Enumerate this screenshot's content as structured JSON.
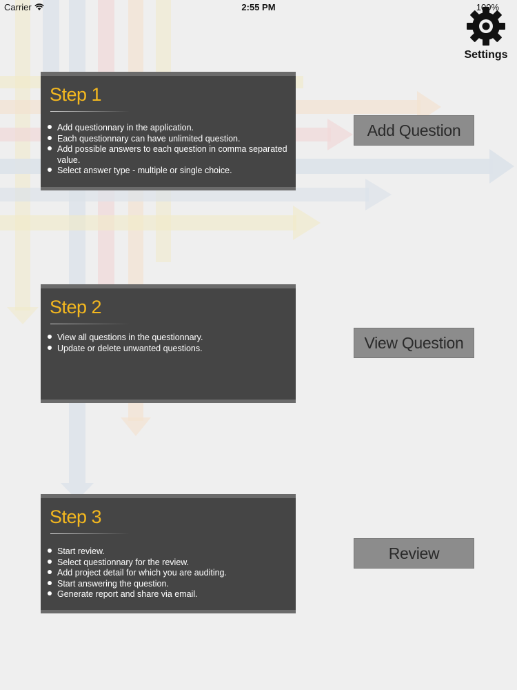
{
  "status_bar": {
    "carrier": "Carrier",
    "time": "2:55 PM",
    "battery": "100%"
  },
  "settings": {
    "label": "Settings",
    "icon": "gear-icon"
  },
  "steps": [
    {
      "title": "Step 1",
      "items": [
        "Add questionnary in the application.",
        "Each questionnary can have unlimited question.",
        "Add possible answers to each question in comma separated value.",
        "Select answer type - multiple or single choice."
      ],
      "button": "Add Question"
    },
    {
      "title": "Step 2",
      "items": [
        "View all questions in the questionnary.",
        "Update or delete unwanted questions."
      ],
      "button": "View Question"
    },
    {
      "title": "Step 3",
      "items": [
        "Start review.",
        "Select questionnary for the review.",
        "Add project detail for which you are auditing.",
        "Start answering the question.",
        "Generate report and share via email."
      ],
      "button": "Review"
    }
  ],
  "colors": {
    "background": "#efefef",
    "panel": "#454545",
    "panel_border": "#6b6b6b",
    "step_title": "#f4b81f",
    "button": "#8c8c8c"
  }
}
